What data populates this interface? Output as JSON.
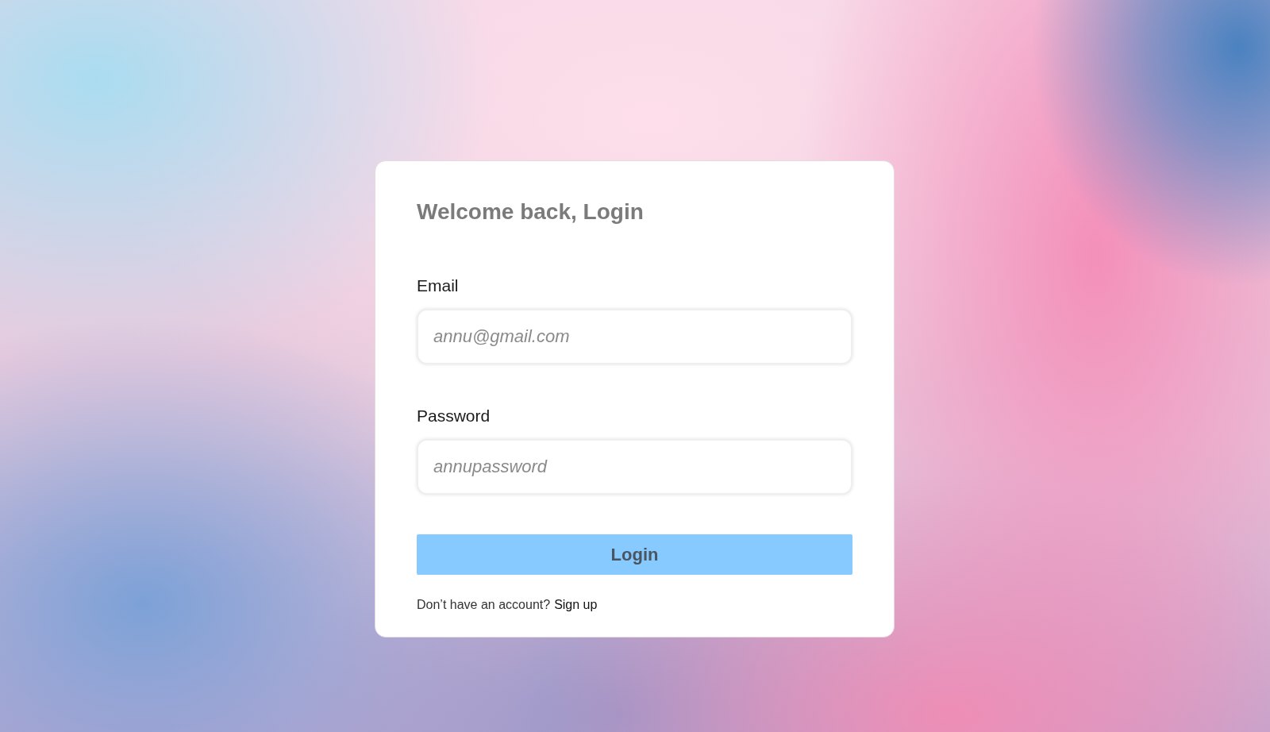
{
  "card": {
    "title": "Welcome back, Login",
    "fields": [
      {
        "label": "Email",
        "placeholder": "annu@gmail.com"
      },
      {
        "label": "Password",
        "placeholder": "annupassword"
      }
    ],
    "submit_button": "Login",
    "footer": {
      "prompt": "Don’t have an account?",
      "link": "Sign up"
    }
  }
}
